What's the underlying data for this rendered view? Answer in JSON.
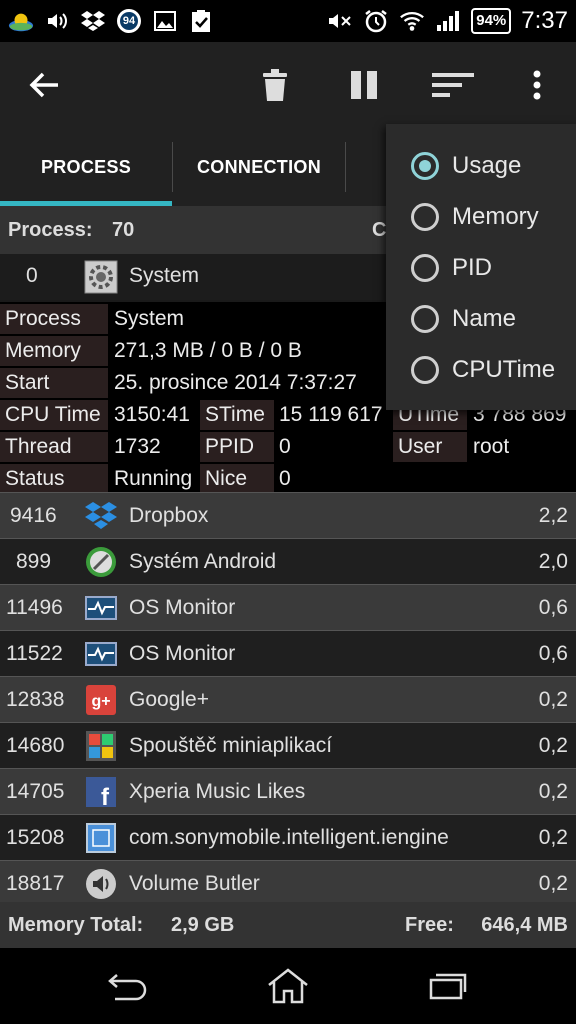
{
  "status_bar": {
    "time": "7:37",
    "battery": "94%",
    "notification_badge": "94",
    "left_icons": [
      "weather-icon",
      "volume-icon",
      "dropbox-icon",
      "badge-icon",
      "image-icon",
      "clipboard-check-icon"
    ],
    "right_icons": [
      "mute-icon",
      "alarm-icon",
      "wifi-icon",
      "signal-icon"
    ]
  },
  "toolbar": {
    "icons": [
      "back-arrow-icon",
      "trash-icon",
      "pause-icon",
      "sort-icon",
      "overflow-menu-icon"
    ]
  },
  "tabs": [
    {
      "label": "PROCESS",
      "active": true
    },
    {
      "label": "CONNECTION",
      "active": false
    }
  ],
  "summary": {
    "process_label": "Process:",
    "process_count": "70",
    "cut_off_text": "C"
  },
  "system_process": {
    "pid": "0",
    "name": "System"
  },
  "details": {
    "process_label": "Process",
    "process_value": "System",
    "memory_label": "Memory",
    "memory_value": "271,3 MB /  0 B / 0 B",
    "start_label": "Start",
    "start_value": "25. prosince 2014 7:37:27",
    "cputime_label": "CPU Time",
    "cputime_value": "3150:41",
    "stime_label": "STime",
    "stime_value": "15 119 617",
    "utime_label": "UTime",
    "utime_value": "3 788 869",
    "thread_label": "Thread",
    "thread_value": "1732",
    "ppid_label": "PPID",
    "ppid_value": "0",
    "user_label": "User",
    "user_value": "root",
    "status_label": "Status",
    "status_value": "Running",
    "nice_label": "Nice",
    "nice_value": "0"
  },
  "processes": [
    {
      "pid": "9416",
      "name": "Dropbox",
      "usage": "2,2",
      "icon": "dropbox-icon"
    },
    {
      "pid": "899",
      "name": "Systém Android",
      "usage": "2,0",
      "icon": "android-system-icon"
    },
    {
      "pid": "11496",
      "name": "OS Monitor",
      "usage": "0,6",
      "icon": "os-monitor-icon"
    },
    {
      "pid": "11522",
      "name": "OS Monitor",
      "usage": "0,6",
      "icon": "os-monitor-icon"
    },
    {
      "pid": "12838",
      "name": "Google+",
      "usage": "0,2",
      "icon": "google-plus-icon"
    },
    {
      "pid": "14680",
      "name": "Spouštěč miniaplikací",
      "usage": "0,2",
      "icon": "widget-launcher-icon"
    },
    {
      "pid": "14705",
      "name": "Xperia Music Likes",
      "usage": "0,2",
      "icon": "facebook-icon"
    },
    {
      "pid": "15208",
      "name": "com.sonymobile.intelligent.iengine",
      "usage": "0,2",
      "icon": "iengine-icon"
    },
    {
      "pid": "18817",
      "name": "Volume Butler",
      "usage": "0,2",
      "icon": "speaker-icon"
    }
  ],
  "footer": {
    "memory_total_label": "Memory Total:",
    "memory_total_value": "2,9 GB",
    "free_label": "Free:",
    "free_value": "646,4 MB"
  },
  "sort_menu": {
    "options": [
      {
        "label": "Usage",
        "selected": true
      },
      {
        "label": "Memory",
        "selected": false
      },
      {
        "label": "PID",
        "selected": false
      },
      {
        "label": "Name",
        "selected": false
      },
      {
        "label": "CPUTime",
        "selected": false
      }
    ]
  },
  "nav_bar": {
    "icons": [
      "back-icon",
      "home-icon",
      "recent-apps-icon"
    ]
  },
  "colors": {
    "accent": "#35b7c4",
    "radio_selected": "#8fd3d8"
  }
}
